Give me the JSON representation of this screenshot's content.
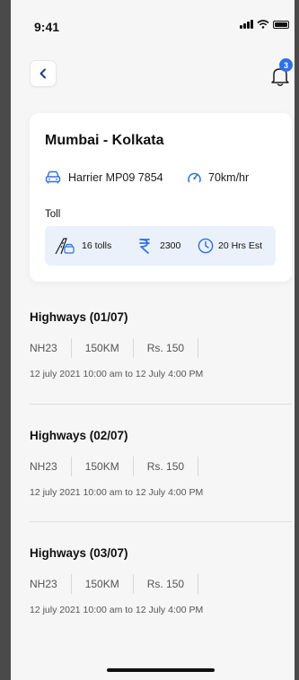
{
  "status": {
    "time": "9:41"
  },
  "header": {
    "notification_count": "3"
  },
  "trip": {
    "route": "Mumbai - Kolkata",
    "vehicle": "Harrier MP09 7854",
    "speed": "70km/hr",
    "toll_label": "Toll",
    "tolls": "16 tolls",
    "cost": "2300",
    "estimate": "20 Hrs Est"
  },
  "highways": [
    {
      "title": "Highways (01/07)",
      "code": "NH23",
      "distance": "150KM",
      "price": "Rs. 150",
      "range": "12 july 2021 10:00 am to 12 July 4:00 PM"
    },
    {
      "title": "Highways (02/07)",
      "code": "NH23",
      "distance": "150KM",
      "price": "Rs. 150",
      "range": "12 july 2021 10:00 am to 12 July 4:00 PM"
    },
    {
      "title": "Highways (03/07)",
      "code": "NH23",
      "distance": "150KM",
      "price": "Rs. 150",
      "range": "12 july 2021 10:00 am to 12 July 4:00 PM"
    }
  ],
  "icons": {
    "back": "chevron-left-icon",
    "bell": "bell-icon",
    "car": "car-icon",
    "speedometer": "speedometer-icon",
    "road": "road-icon",
    "rupee": "rupee-icon",
    "clock": "clock-icon"
  },
  "colors": {
    "accent": "#2f6fe4",
    "toll_box_bg": "#eaf1fb",
    "background": "#f6f6f6"
  }
}
